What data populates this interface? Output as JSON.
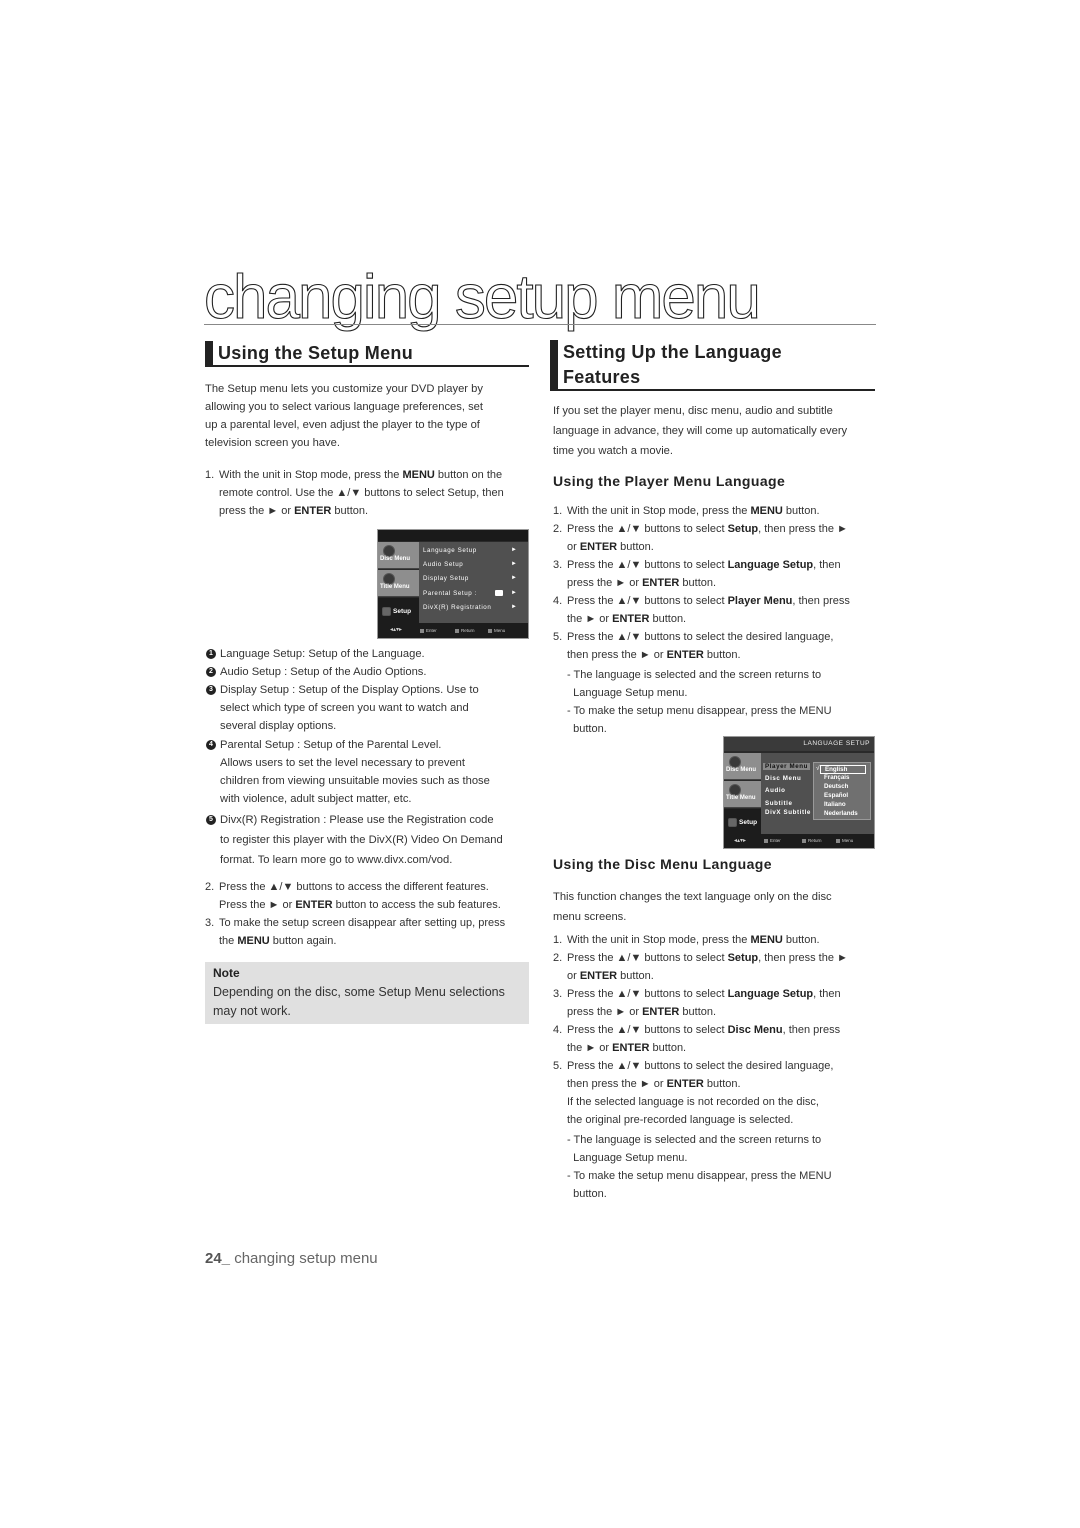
{
  "page": {
    "title": "changing setup menu",
    "footer_page_num": "24_",
    "footer_text": " changing setup menu"
  },
  "left": {
    "heading": "Using the Setup Menu",
    "intro": [
      "The Setup menu lets you customize your DVD player by",
      "allowing you to select various language preferences, set",
      "up a parental level, even adjust the player to the type of",
      "television screen you have."
    ],
    "step1": {
      "num": "1.",
      "lines": [
        [
          "With the unit in Stop mode, press the ",
          "MENU",
          " button on the"
        ],
        [
          "remote control.  Use the ▲/▼ buttons to select Setup, then",
          "",
          ""
        ],
        [
          "press the ► or ",
          "ENTER",
          " button."
        ]
      ]
    },
    "menu_screen": {
      "side_items": [
        "Disc Menu",
        "Title Menu",
        "Setup"
      ],
      "rows": [
        {
          "label": "Language Setup",
          "arrow": "►"
        },
        {
          "label": "Audio Setup",
          "arrow": "►"
        },
        {
          "label": "Display Setup",
          "arrow": "►"
        },
        {
          "label": "Parental Setup :",
          "arrow": "►"
        },
        {
          "label": "DivX(R) Registration",
          "arrow": "►"
        }
      ],
      "hints": [
        "Enter",
        "Return",
        "Menu"
      ],
      "dpad": "◂▴▾▸"
    },
    "bullets": [
      {
        "marker": "1",
        "lines": [
          "Language Setup: Setup of the Language."
        ]
      },
      {
        "marker": "2",
        "lines": [
          "Audio Setup : Setup of the Audio Options."
        ]
      },
      {
        "marker": "3",
        "lines": [
          "Display Setup : Setup of the Display Options. Use to",
          "select which type of screen you want to watch and",
          "several display options."
        ]
      },
      {
        "marker": "4",
        "lines": [
          "Parental Setup : Setup of the Parental Level.",
          "Allows users to set the level necessary to prevent",
          "children from viewing unsuitable movies such as those",
          "with violence, adult subject matter, etc."
        ]
      },
      {
        "marker": "5",
        "lines": [
          "Divx(R) Registration : Please use the Registration code",
          "to register this player with the DivX(R) Video On Demand",
          "format. To learn more go to www.divx.com/vod."
        ]
      }
    ],
    "step2": {
      "num": "2.",
      "line1": "Press the ▲/▼ buttons to access the different  features.",
      "line2_a": "Press the ► or ",
      "line2_b": "ENTER",
      "line2_c": " button to access the sub features."
    },
    "step3": {
      "num": "3.",
      "line1": "To make the setup screen disappear after setting up, press",
      "line2_a": "the ",
      "line2_b": "MENU",
      "line2_c": " button again."
    },
    "note": {
      "title": "Note",
      "body": "Depending on the disc, some Setup Menu selections may not work."
    }
  },
  "right": {
    "heading_line1": "Setting Up the Language",
    "heading_line2": "Features",
    "intro": [
      "If you set the player menu, disc menu, audio and subtitle",
      "language in advance, they will come up automatically every",
      "time you watch a movie."
    ],
    "player_section": {
      "heading": "Using the Player Menu Language",
      "steps": [
        {
          "num": "1.",
          "lines": [
            [
              "With the unit in Stop mode, press the ",
              "MENU",
              " button."
            ]
          ]
        },
        {
          "num": "2.",
          "lines": [
            [
              "Press the ▲/▼ buttons to select ",
              "Setup",
              ", then press the ►"
            ],
            [
              "or ",
              "ENTER",
              " button."
            ]
          ]
        },
        {
          "num": "3.",
          "lines": [
            [
              "Press the ▲/▼ buttons to select ",
              "Language Setup",
              ", then"
            ],
            [
              "press the ► or ",
              "ENTER",
              " button."
            ]
          ]
        },
        {
          "num": "4.",
          "lines": [
            [
              "Press the ▲/▼ buttons to select ",
              "Player Menu",
              ", then press"
            ],
            [
              "the ► or ",
              "ENTER",
              " button."
            ]
          ]
        },
        {
          "num": "5.",
          "lines": [
            [
              "Press the ▲/▼ buttons to select the desired language,",
              "",
              ""
            ],
            [
              "then press the ► or ",
              "ENTER",
              " button."
            ]
          ]
        }
      ],
      "subnotes": [
        [
          "- The language is selected and the screen returns to",
          "  Language Setup menu."
        ],
        [
          "- To make the setup menu disappear, press the MENU",
          "  button."
        ]
      ]
    },
    "lang_screen": {
      "title": "LANGUAGE SETUP",
      "side_items": [
        "Disc Menu",
        "Title Menu",
        "Setup"
      ],
      "rows": [
        "Player Menu",
        "Disc Menu",
        "Audio",
        "Subtitle",
        "DivX Subtitle"
      ],
      "check": "√",
      "languages": [
        "English",
        "Français",
        "Deutsch",
        "Español",
        "Italiano",
        "Nederlands"
      ],
      "selected_language": "English",
      "hints": [
        "Enter",
        "Return",
        "Menu"
      ],
      "dpad": "◂▴▾▸"
    },
    "disc_section": {
      "heading": "Using the Disc Menu Language",
      "intro": [
        "This function changes the text language only on the disc",
        "menu screens."
      ],
      "steps": [
        {
          "num": "1.",
          "lines": [
            [
              "With the unit in Stop mode, press the ",
              "MENU",
              " button."
            ]
          ]
        },
        {
          "num": "2.",
          "lines": [
            [
              "Press the ▲/▼ buttons to select ",
              "Setup",
              ", then press the ►"
            ],
            [
              "or ",
              "ENTER",
              " button."
            ]
          ]
        },
        {
          "num": "3.",
          "lines": [
            [
              "Press the ▲/▼ buttons to select ",
              "Language Setup",
              ", then"
            ],
            [
              "press the ► or ",
              "ENTER",
              " button."
            ]
          ]
        },
        {
          "num": "4.",
          "lines": [
            [
              "Press the  ▲/▼ buttons to select ",
              "Disc Menu",
              ", then press"
            ],
            [
              "the ► or ",
              "ENTER",
              "  button."
            ]
          ]
        },
        {
          "num": "5.",
          "lines": [
            [
              "Press the ▲/▼ buttons to select the desired language,",
              "",
              ""
            ],
            [
              "then press the ► or ",
              "ENTER",
              " button."
            ],
            [
              "If the selected language is not recorded on  the disc,",
              "",
              ""
            ],
            [
              "the original pre-recorded language is selected.",
              "",
              ""
            ]
          ]
        }
      ],
      "subnotes": [
        [
          "- The language is selected and the screen returns to",
          "  Language Setup menu."
        ],
        [
          "- To make the setup menu disappear, press the MENU",
          "  button."
        ]
      ]
    }
  }
}
